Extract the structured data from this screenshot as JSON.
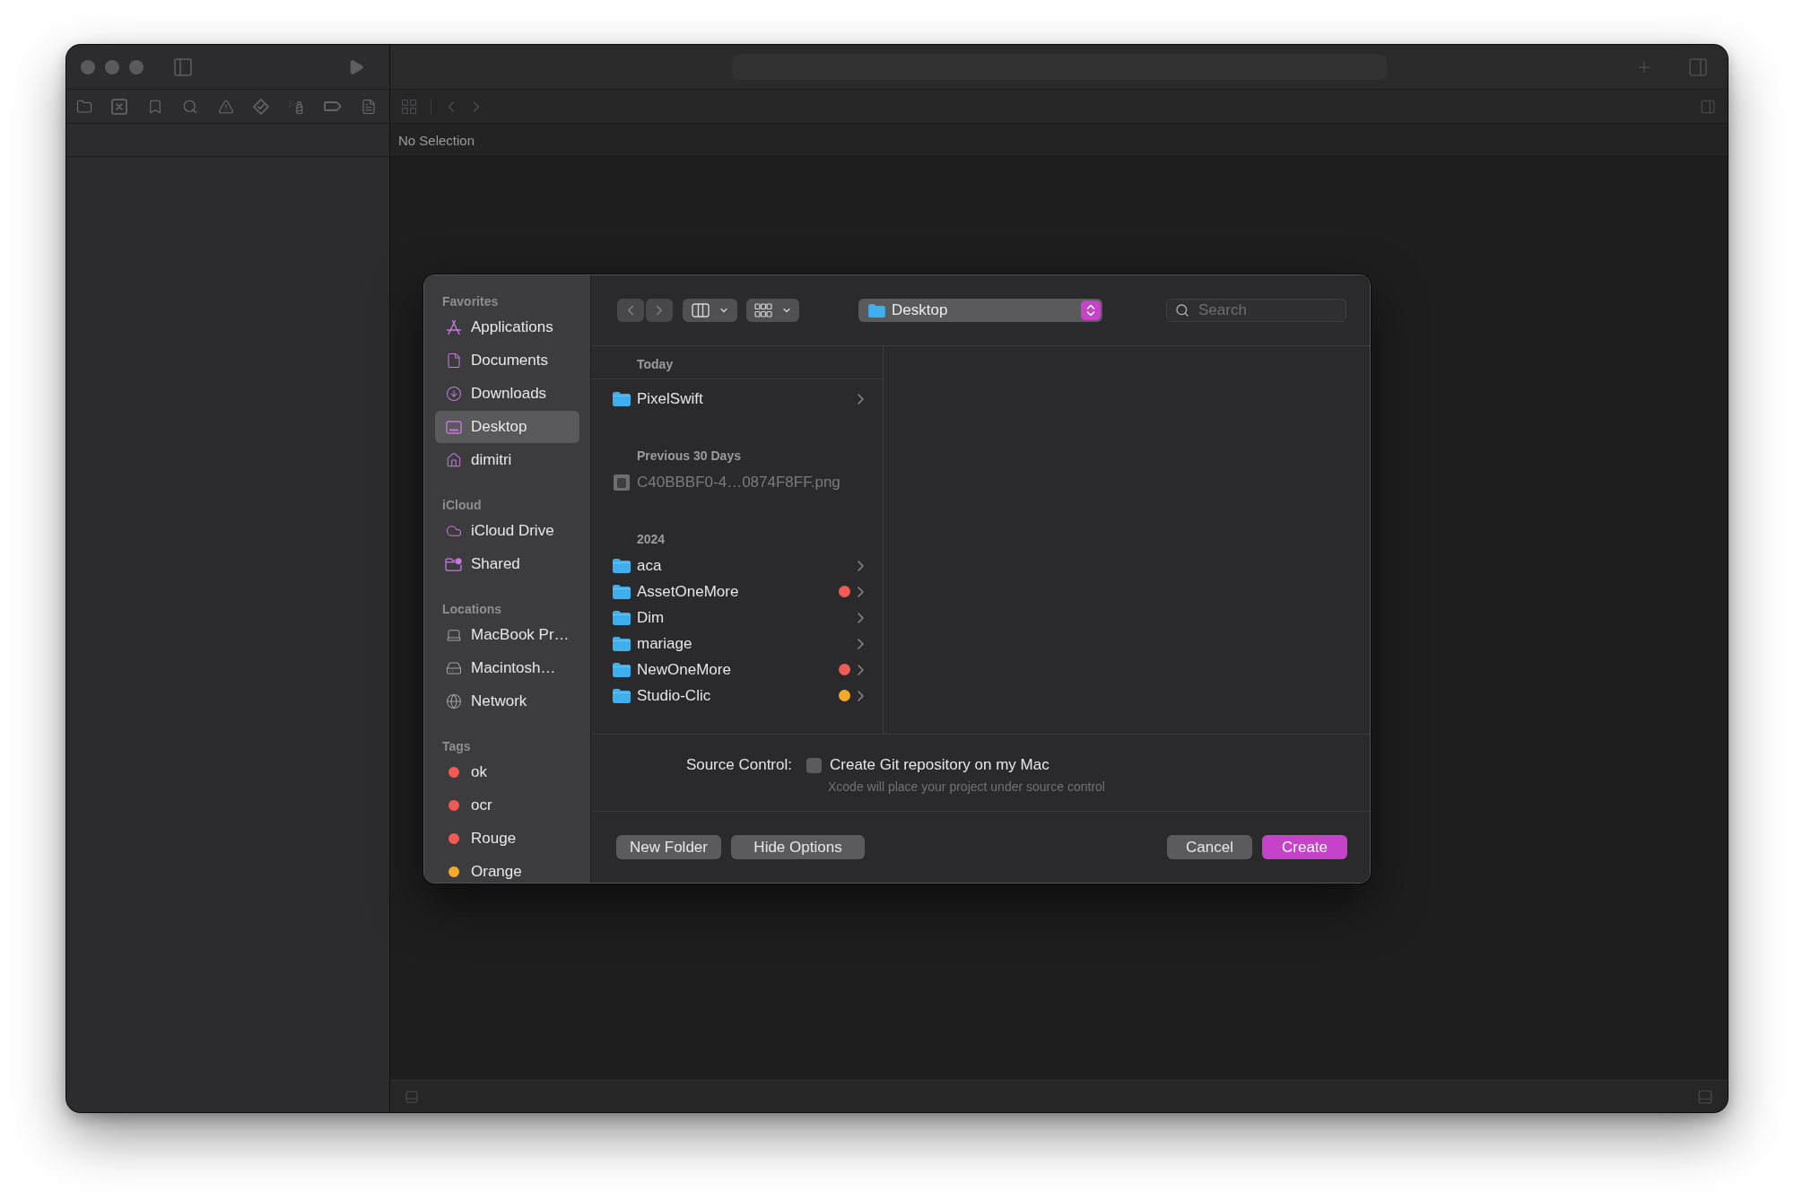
{
  "xcode_window": {
    "jump_bar": {
      "text": "No Selection"
    }
  },
  "save_dialog": {
    "sidebar": {
      "sections": [
        {
          "title": "Favorites",
          "items": [
            {
              "label": "Applications",
              "selected": false
            },
            {
              "label": "Documents",
              "selected": false
            },
            {
              "label": "Downloads",
              "selected": false
            },
            {
              "label": "Desktop",
              "selected": true
            },
            {
              "label": "dimitri",
              "selected": false
            }
          ]
        },
        {
          "title": "iCloud",
          "items": [
            {
              "label": "iCloud Drive",
              "selected": false
            },
            {
              "label": "Shared",
              "selected": false
            }
          ]
        },
        {
          "title": "Locations",
          "items": [
            {
              "label": "MacBook Pr…",
              "selected": false
            },
            {
              "label": "Macintosh…",
              "selected": false
            },
            {
              "label": "Network",
              "selected": false
            }
          ]
        },
        {
          "title": "Tags",
          "items": [
            {
              "label": "ok",
              "selected": false,
              "color": "#f25b55"
            },
            {
              "label": "ocr",
              "selected": false,
              "color": "#f25b55"
            },
            {
              "label": "Rouge",
              "selected": false,
              "color": "#f25b55"
            },
            {
              "label": "Orange",
              "selected": false,
              "color": "#f7a829"
            }
          ]
        }
      ]
    },
    "toolbar": {
      "location": "Desktop",
      "search": {
        "placeholder": "Search"
      }
    },
    "file_list": {
      "groups": [
        {
          "title": "Today",
          "items": [
            {
              "name": "PixelSwift",
              "kind": "folder",
              "disabled": false
            }
          ]
        },
        {
          "title": "Previous 30 Days",
          "items": [
            {
              "name": "C40BBBF0-4…0874F8FF.png",
              "kind": "image",
              "disabled": true
            }
          ]
        },
        {
          "title": "2024",
          "items": [
            {
              "name": "aca",
              "kind": "folder",
              "disabled": false
            },
            {
              "name": "AssetOneMore",
              "kind": "folder",
              "disabled": false,
              "color": "#f25b55"
            },
            {
              "name": "Dim",
              "kind": "folder",
              "disabled": false
            },
            {
              "name": "mariage",
              "kind": "folder",
              "disabled": false
            },
            {
              "name": "NewOneMore",
              "kind": "folder",
              "disabled": false,
              "color": "#f25b55"
            },
            {
              "name": "Studio-Clic",
              "kind": "folder",
              "disabled": false,
              "color": "#f7a829"
            }
          ]
        }
      ]
    },
    "options": {
      "label": "Source Control:",
      "checkbox": {
        "label": "Create Git repository on my Mac",
        "checked": false
      },
      "hint": "Xcode will place your project under source control"
    },
    "buttons": {
      "left": [
        {
          "label": "New Folder",
          "default": false
        },
        {
          "label": "Hide Options",
          "default": false
        }
      ],
      "right": [
        {
          "label": "Cancel",
          "default": false
        },
        {
          "label": "Create",
          "default": true
        }
      ]
    }
  }
}
